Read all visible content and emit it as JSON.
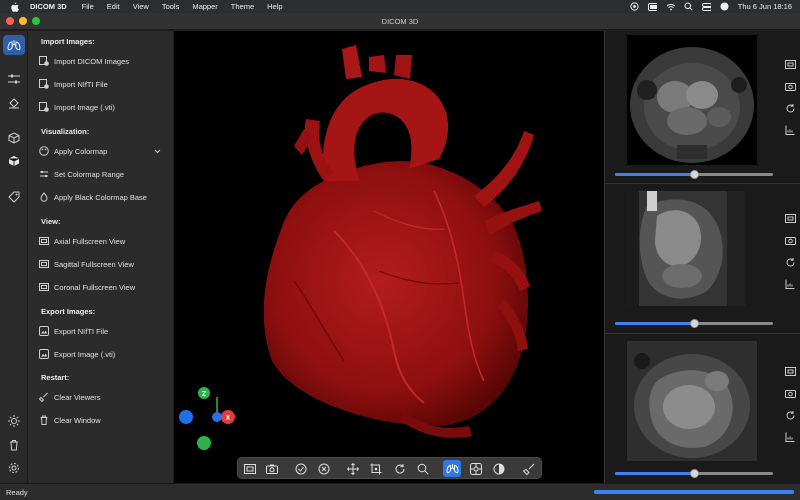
{
  "menubar": {
    "app_name": "DICOM 3D",
    "items": [
      "File",
      "Edit",
      "View",
      "Tools",
      "Mapper",
      "Theme",
      "Help"
    ],
    "clock": "Thu 6 Jun  18:16"
  },
  "window": {
    "title": "DICOM 3D"
  },
  "sidebar": {
    "sections": {
      "import": "Import Images:",
      "visualization": "Visualization:",
      "view": "View:",
      "export": "Export Images:",
      "restart": "Restart:"
    },
    "items": {
      "import_dicom": "Import DICOM Images",
      "import_nifti": "Import NIfTI File",
      "import_vti": "Import Image (.vti)",
      "apply_colormap": "Apply Colormap",
      "set_colormap_range": "Set Colormap Range",
      "apply_black_colormap": "Apply Black Colormap Base",
      "axial_fullscreen": "Axial Fullscreen View",
      "sagittal_fullscreen": "Sagittal Fullscreen View",
      "coronal_fullscreen": "Coronal Fullscreen View",
      "export_nifti": "Export NIfTI File",
      "export_vti": "Export Image (.vti)",
      "clear_viewers": "Clear Viewers",
      "clear_window": "Clear Window"
    }
  },
  "axes": {
    "z": "Z",
    "x": "X"
  },
  "slices": {
    "axial_position": 0.5,
    "sagittal_position": 0.5,
    "coronal_position": 0.5
  },
  "status": {
    "text": "Ready",
    "progress": 1.0
  },
  "colors": {
    "accent": "#2f78e6",
    "heart": "#a41414",
    "axis_x": "#e03c3c",
    "axis_y": "#2f6fe6",
    "axis_z": "#2fb24a"
  }
}
